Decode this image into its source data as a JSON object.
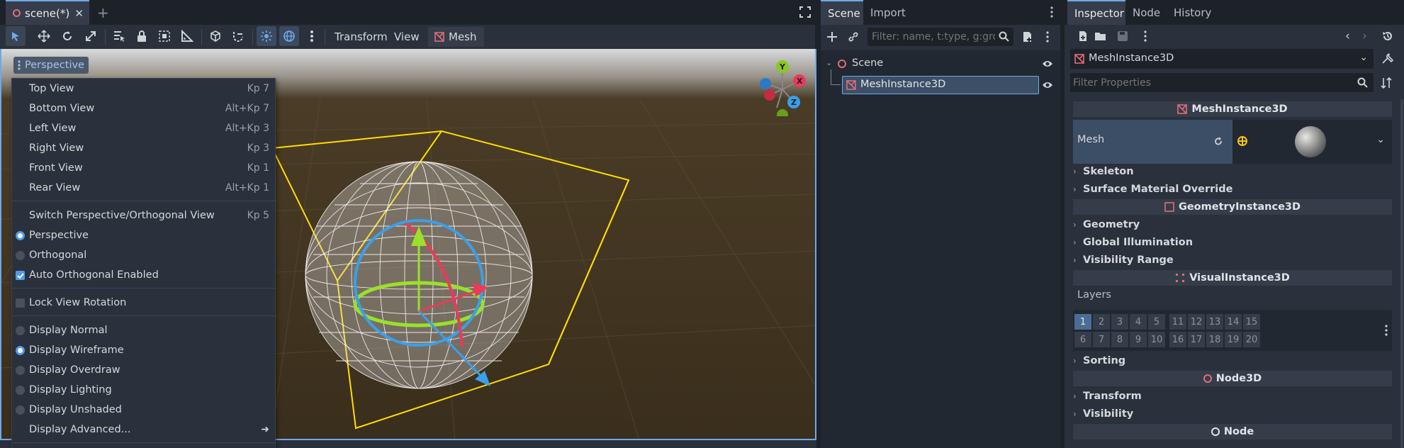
{
  "colors": {
    "accent": "#6ea9e8",
    "scene_bg": "#3a2e1c",
    "selection_yellow": "#ffdd00",
    "node_red": "#e06c7a"
  },
  "editor": {
    "scene_tab": "scene(*)",
    "toolbar": {
      "transform_label": "Transform",
      "view_label": "View",
      "mesh_label": "Mesh"
    },
    "viewport": {
      "perspective_label": "Perspective",
      "gizmo": {
        "y": "Y",
        "x": "X",
        "z": "Z"
      },
      "menu": [
        {
          "label": "Top View",
          "shortcut": "Kp 7"
        },
        {
          "label": "Bottom View",
          "shortcut": "Alt+Kp 7"
        },
        {
          "label": "Left View",
          "shortcut": "Alt+Kp 3"
        },
        {
          "label": "Right View",
          "shortcut": "Kp 3"
        },
        {
          "label": "Front View",
          "shortcut": "Kp 1"
        },
        {
          "label": "Rear View",
          "shortcut": "Alt+Kp 1"
        },
        {
          "label": "Switch Perspective/Orthogonal View",
          "shortcut": "Kp 5"
        },
        {
          "label": "Perspective",
          "checked": true
        },
        {
          "label": "Orthogonal",
          "checked": false
        },
        {
          "label": "Auto Orthogonal Enabled",
          "checked": true
        },
        {
          "label": "Lock View Rotation",
          "checked": false
        },
        {
          "label": "Display Normal",
          "checked": false
        },
        {
          "label": "Display Wireframe",
          "checked": true
        },
        {
          "label": "Display Overdraw",
          "checked": false
        },
        {
          "label": "Display Lighting",
          "checked": false
        },
        {
          "label": "Display Unshaded",
          "checked": false
        },
        {
          "label": "Display Advanced..."
        }
      ]
    }
  },
  "scene_dock": {
    "tabs": [
      "Scene",
      "Import"
    ],
    "filter_placeholder": "Filter: name, t:type, g:grou",
    "tree": [
      {
        "label": "Scene"
      },
      {
        "label": "MeshInstance3D"
      }
    ]
  },
  "inspector": {
    "tabs": [
      "Inspector",
      "Node",
      "History"
    ],
    "object": "MeshInstance3D",
    "filter_placeholder": "Filter Properties",
    "sections": {
      "mesh_instance": "MeshInstance3D",
      "mesh_prop": "Mesh",
      "skeleton": "Skeleton",
      "surface": "Surface Material Override",
      "geometry_instance": "GeometryInstance3D",
      "geometry": "Geometry",
      "gi": "Global Illumination",
      "visibility_range": "Visibility Range",
      "visual_instance": "VisualInstance3D",
      "layers": "Layers",
      "sorting": "Sorting",
      "node3d": "Node3D",
      "transform": "Transform",
      "visibility": "Visibility",
      "node": "Node"
    },
    "layers_row1": [
      "1",
      "2",
      "3",
      "4",
      "5",
      "11",
      "12",
      "13",
      "14",
      "15"
    ],
    "layers_row2": [
      "6",
      "7",
      "8",
      "9",
      "10",
      "16",
      "17",
      "18",
      "19",
      "20"
    ],
    "active_layer": "1"
  }
}
